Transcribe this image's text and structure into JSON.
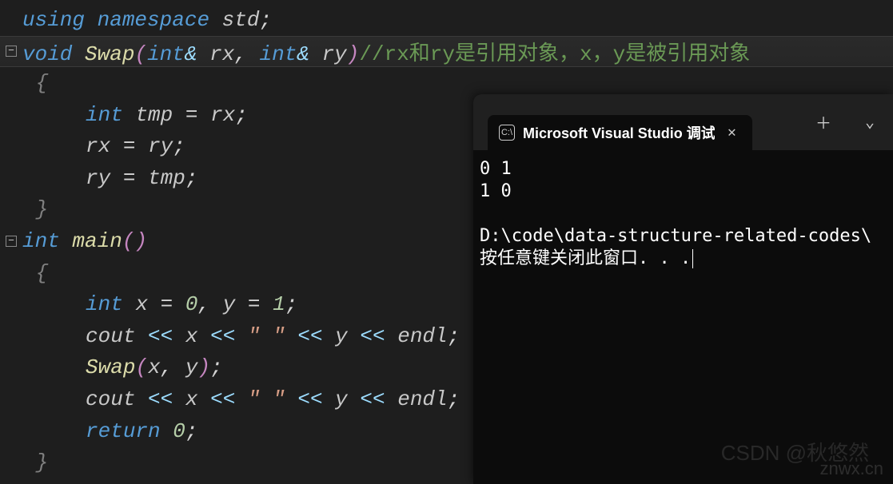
{
  "code": {
    "l1": {
      "using": "using",
      "namespace": "namespace",
      "std": "std",
      "semi": ";"
    },
    "l2": {
      "void": "void",
      "fn": "Swap",
      "lp": "(",
      "int1": "int",
      "amp1": "&",
      "p1": "rx",
      "comma": ",",
      "int2": "int",
      "amp2": "&",
      "p2": "ry",
      "rp": ")",
      "comment": "//rx和ry是引用对象，x，y是被引用对象"
    },
    "l3": {
      "brace": "{"
    },
    "l4": {
      "int": "int",
      "var": "tmp",
      "eq": "=",
      "rhs": "rx",
      "semi": ";"
    },
    "l5": {
      "lhs": "rx",
      "eq": "=",
      "rhs": "ry",
      "semi": ";"
    },
    "l6": {
      "lhs": "ry",
      "eq": "=",
      "rhs": "tmp",
      "semi": ";"
    },
    "l7": {
      "brace": "}"
    },
    "l8": {
      "int": "int",
      "fn": "main",
      "lp": "(",
      "rp": ")"
    },
    "l9": {
      "brace": "{"
    },
    "l10": {
      "int": "int",
      "x": "x",
      "eq1": "=",
      "v1": "0",
      "comma": ",",
      "y": "y",
      "eq2": "=",
      "v2": "1",
      "semi": ";"
    },
    "l11": {
      "cout": "cout",
      "lt1": "<<",
      "x": "x",
      "lt2": "<<",
      "str": "\" \"",
      "lt3": "<<",
      "y": "y",
      "lt4": "<<",
      "endl": "endl",
      "semi": ";"
    },
    "l12": {
      "fn": "Swap",
      "lp": "(",
      "x": "x",
      "comma": ",",
      "y": "y",
      "rp": ")",
      "semi": ";"
    },
    "l13": {
      "cout": "cout",
      "lt1": "<<",
      "x": "x",
      "lt2": "<<",
      "str": "\" \"",
      "lt3": "<<",
      "y": "y",
      "lt4": "<<",
      "endl": "endl",
      "semi": ";"
    },
    "l14": {
      "ret": "return",
      "v": "0",
      "semi": ";"
    },
    "l15": {
      "brace": "}"
    }
  },
  "terminal": {
    "tabTitle": "Microsoft Visual Studio 调试",
    "out1": "0 1",
    "out2": "1 0",
    "blank": "",
    "path": "D:\\code\\data-structure-related-codes\\",
    "prompt": "按任意键关闭此窗口. . ."
  },
  "watermark1": "znwx.cn",
  "watermark2": "CSDN @秋悠然"
}
